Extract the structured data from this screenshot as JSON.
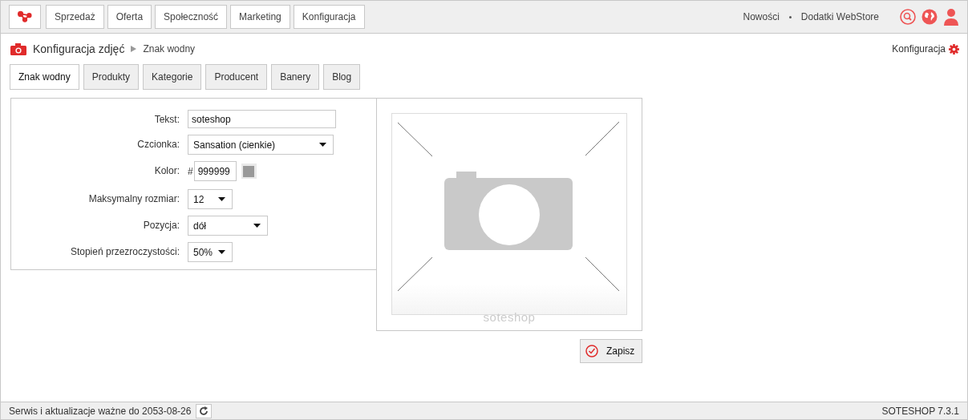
{
  "top_nav": {
    "items": [
      {
        "label": "Sprzedaż"
      },
      {
        "label": "Oferta"
      },
      {
        "label": "Społeczność"
      },
      {
        "label": "Marketing"
      },
      {
        "label": "Konfiguracja"
      }
    ],
    "links": [
      "Nowości",
      "Dodatki WebStore"
    ]
  },
  "breadcrumb": {
    "section": "Konfiguracja zdjęć",
    "current": "Znak wodny",
    "config_link": "Konfiguracja"
  },
  "tabs": [
    {
      "label": "Znak wodny",
      "selected": true
    },
    {
      "label": "Produkty",
      "selected": false
    },
    {
      "label": "Kategorie",
      "selected": false
    },
    {
      "label": "Producent",
      "selected": false
    },
    {
      "label": "Banery",
      "selected": false
    },
    {
      "label": "Blog",
      "selected": false
    }
  ],
  "form": [
    {
      "kind": "text",
      "label": "Tekst:",
      "value": "soteshop"
    },
    {
      "kind": "select",
      "label": "Czcionka:",
      "value": "Sansation (cienkie)"
    },
    {
      "kind": "color",
      "label": "Kolor:",
      "prefix": "#",
      "value": "999999",
      "color": "#999999"
    },
    {
      "kind": "select",
      "label": "Maksymalny rozmiar:",
      "value": "12"
    },
    {
      "kind": "select",
      "label": "Pozycja:",
      "value": "dół"
    },
    {
      "kind": "select",
      "label": "Stopień przezroczystości:",
      "value": "50%"
    }
  ],
  "preview": {
    "watermark_text": "soteshop"
  },
  "save_button": "Zapisz",
  "status_bar": {
    "license": "Serwis i aktualizacje ważne do 2053-08-26",
    "version": "SOTESHOP 7.3.1"
  }
}
